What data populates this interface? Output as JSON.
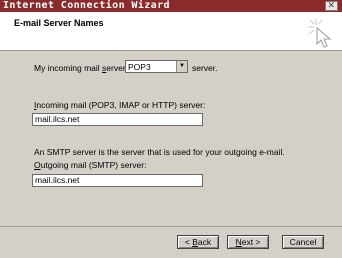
{
  "window": {
    "title": "Internet Connection Wizard",
    "close_glyph": "✕"
  },
  "header": {
    "title": "E-mail Server Names",
    "icon": "wizard-cursor-icon"
  },
  "incoming_type": {
    "prefix": "My incoming mail ",
    "underlined": "s",
    "middle": "erver is a",
    "selected": "POP3",
    "suffix": "server."
  },
  "incoming_server": {
    "label_underlined": "I",
    "label_rest": "ncoming mail (POP3, IMAP or HTTP) server:",
    "value": "mail.ilcs.net"
  },
  "smtp_note": "An SMTP server is the server that is used for your outgoing e-mail.",
  "outgoing_server": {
    "label_underlined": "O",
    "label_rest": "utgoing mail (SMTP) server:",
    "value": "mail.ilcs.net"
  },
  "buttons": {
    "back_prefix": "< ",
    "back_u": "B",
    "back_rest": "ack",
    "next_u": "N",
    "next_rest": "ext >",
    "cancel": "Cancel"
  }
}
